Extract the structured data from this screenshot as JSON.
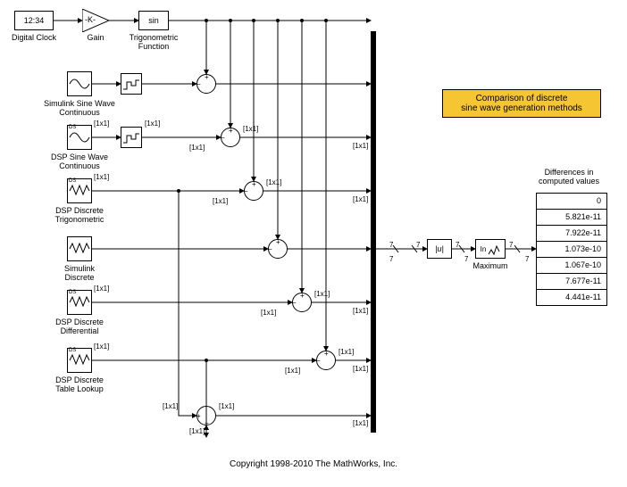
{
  "top": {
    "clock": {
      "label": "Digital Clock",
      "value": "12:34"
    },
    "gain": {
      "label": "Gain",
      "symbol": "-K-"
    },
    "trig": {
      "label": "Trigonometric\nFunction",
      "fn": "sin"
    }
  },
  "sources": [
    {
      "label": "Simulink Sine Wave\nContinuous",
      "prefix": ""
    },
    {
      "label": "DSP Sine Wave\nContinuous",
      "prefix": "DS"
    },
    {
      "label": "DSP Discrete\nTrigonometric",
      "prefix": "DS"
    },
    {
      "label": "Simulink\nDiscrete",
      "prefix": ""
    },
    {
      "label": "DSP Discrete\nDifferential",
      "prefix": "DS"
    },
    {
      "label": "DSP Discrete\nTable Lookup",
      "prefix": "DS"
    }
  ],
  "sig": {
    "dim": "[1x1]",
    "bus": "7"
  },
  "abs": {
    "symbol": "|u|"
  },
  "max": {
    "label": "Maximum",
    "symbol": "In"
  },
  "annotation": {
    "title": "Comparison of discrete\nsine wave generation methods"
  },
  "display": {
    "title": "Differences in\ncomputed values",
    "values": [
      "0",
      "5.821e-11",
      "7.922e-11",
      "1.073e-10",
      "1.067e-10",
      "7.677e-11",
      "4.441e-11"
    ]
  },
  "footer": "Copyright 1998-2010 The MathWorks, Inc."
}
